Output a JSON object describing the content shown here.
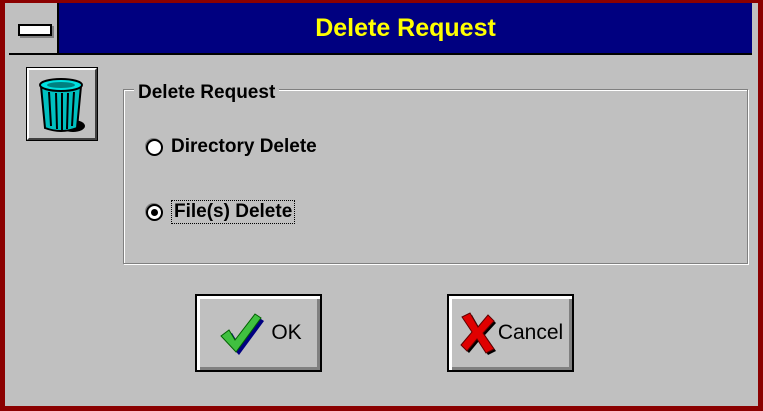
{
  "window": {
    "title": "Delete Request",
    "title_color": "#ffff00",
    "titlebar_color": "#000080",
    "frame_color": "#8b0000"
  },
  "system_menu": {
    "icon": "system-menu-icon"
  },
  "dialog_icon": {
    "icon": "trash-can-icon"
  },
  "group": {
    "label": "Delete Request",
    "options": [
      {
        "label": "Directory Delete",
        "checked": false
      },
      {
        "label": "File(s) Delete",
        "checked": true
      }
    ]
  },
  "buttons": {
    "ok": {
      "label": "OK",
      "icon": "checkmark-icon"
    },
    "cancel": {
      "label": "Cancel",
      "icon": "x-mark-icon"
    }
  }
}
